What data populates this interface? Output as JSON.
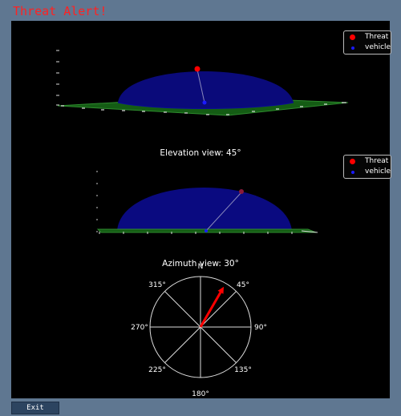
{
  "alert_title": "Threat Alert!",
  "legend": {
    "threat_label": "Threat",
    "vehicle_label": "vehicle",
    "threat_color": "#ff0000",
    "vehicle_color": "#1a1aff"
  },
  "elevation_view": {
    "caption": "Elevation view: 45°"
  },
  "azimuth_view": {
    "caption": "Azimuth view: 30°",
    "azimuth_deg": 30,
    "north_label": "N",
    "labels": [
      "45°",
      "90°",
      "135°",
      "180°",
      "225°",
      "270°",
      "315°"
    ]
  },
  "exit_button": {
    "label": "Exit"
  },
  "colors": {
    "dome": "#0a0a8a",
    "ground": "#1a6b1a",
    "arrow": "#ff0000",
    "panel": "#000000",
    "window": "#5f7791"
  }
}
